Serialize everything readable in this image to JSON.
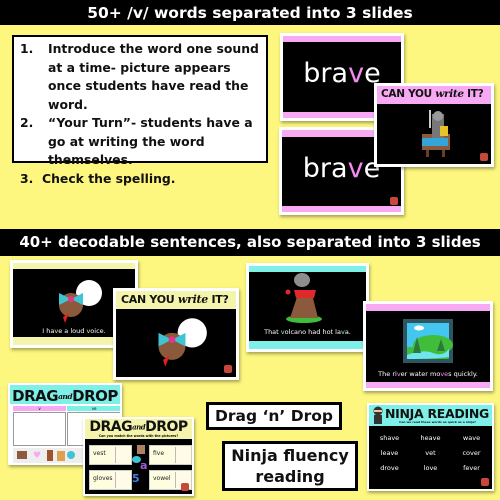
{
  "banner_top": "50+ /v/ words separated into 3 slides",
  "banner_middle": "40+ decodable sentences, also separated into 3 slides",
  "steps": [
    {
      "num": "1.",
      "text": "Introduce the word one sound at a time- picture appears once students have read the word."
    },
    {
      "num": "2.",
      "text": "“Your Turn”- students have a go at writing the word themselves."
    },
    {
      "num": "3.",
      "text": "Check the spelling."
    }
  ],
  "word_slides": {
    "word_prefix": "bra",
    "word_highlight": "v",
    "word_suffix": "e",
    "can_you_write_it": {
      "part1": "CAN YOU ",
      "script": "write",
      "part2": " IT?"
    },
    "picture": "knight-on-horse-icon"
  },
  "sentence_slides": [
    {
      "text_parts": [
        "I ha",
        "v",
        "e a loud ",
        "v",
        "oice."
      ],
      "picture": "girl-shouting-icon"
    },
    {
      "text_parts": [
        "That ",
        "v",
        "olcano had hot la",
        "v",
        "a."
      ],
      "picture": "volcano-icon"
    },
    {
      "text_parts": [
        "The ri",
        "v",
        "er water mo",
        "ve",
        "s quickly."
      ],
      "picture": "river-landscape-icon"
    }
  ],
  "sentence_cyw": {
    "part1": "CAN YOU ",
    "script": "write",
    "part2": " IT?"
  },
  "drag_drop": {
    "title_left": "DRAG",
    "title_script": "and",
    "title_right": "DROP",
    "subtitle": "Can you match the words with the pictures?",
    "sort_headers": [
      "v",
      "ve"
    ],
    "words": [
      "vest",
      "five",
      "gloves",
      "vowel"
    ],
    "floating_letters": [
      "a",
      "5"
    ]
  },
  "labels": {
    "drag_n_drop": "Drag ‘n’ Drop",
    "ninja_line1": "Ninja fluency",
    "ninja_line2": "reading"
  },
  "ninja": {
    "title": "NINJA READING",
    "subtitle": "Can we read these words as quick as a ninja?",
    "words": [
      "shave",
      "heave",
      "wave",
      "leave",
      "vet",
      "cover",
      "drove",
      "love",
      "fever"
    ]
  },
  "colors": {
    "background": "#fdf77f",
    "pink": "#f7a9f3",
    "cyan": "#7ff0e8",
    "pale_yellow": "#f5f4ad"
  }
}
